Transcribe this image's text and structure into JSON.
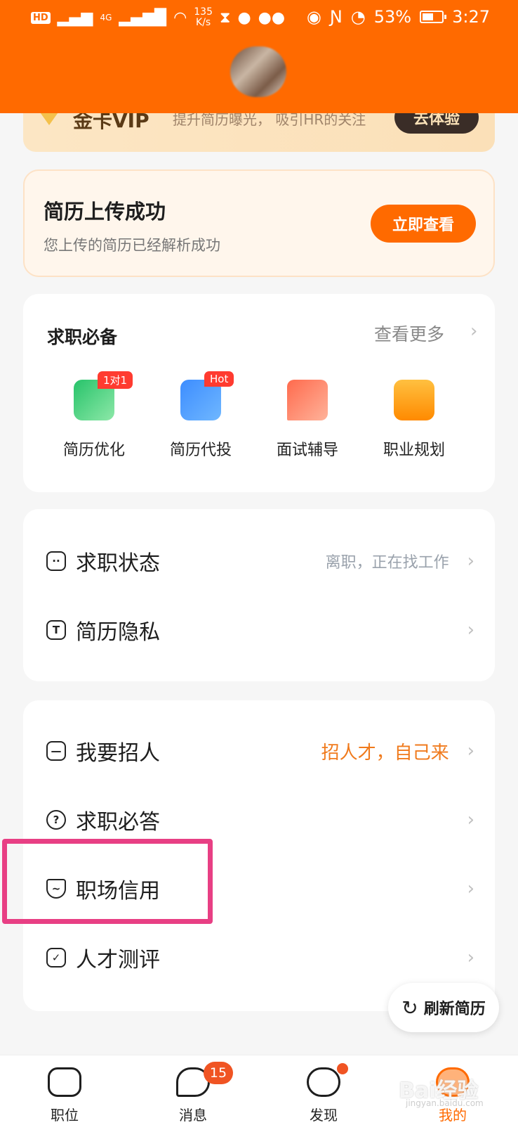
{
  "status_bar": {
    "hd": "HD",
    "network": "4G",
    "net_speed_value": "135",
    "net_speed_unit": "K/s",
    "battery": "53%",
    "time": "3:27"
  },
  "vip": {
    "title": "金卡VIP",
    "desc": "提升简历曝光， 吸引HR的关注",
    "button": "去体验"
  },
  "upload": {
    "title": "简历上传成功",
    "desc": "您上传的简历已经解析成功",
    "button": "立即查看"
  },
  "essentials": {
    "title": "求职必备",
    "more": "查看更多",
    "tools": [
      {
        "label": "简历优化",
        "tag": "1对1",
        "icon": "resume-edit-icon"
      },
      {
        "label": "简历代投",
        "tag": "Hot",
        "icon": "mail-star-icon"
      },
      {
        "label": "面试辅导",
        "tag": "",
        "icon": "chat-bubble-icon"
      },
      {
        "label": "职业规划",
        "tag": "",
        "icon": "briefcase-icon"
      }
    ]
  },
  "settings": {
    "status": {
      "label": "求职状态",
      "value": "离职，正在找工作"
    },
    "privacy": {
      "label": "简历隐私"
    }
  },
  "more": {
    "recruit": {
      "label": "我要招人",
      "value": "招人才，自己来"
    },
    "qa": {
      "label": "求职必答"
    },
    "credit": {
      "label": "职场信用"
    },
    "assess": {
      "label": "人才测评"
    }
  },
  "refresh": {
    "label": "刷新简历"
  },
  "nav": {
    "jobs": "职位",
    "messages": "消息",
    "messages_badge": "15",
    "discover": "发现",
    "mine": "我的"
  },
  "watermark": {
    "main": "Bai经验",
    "sub": "jingyan.baidu.com"
  },
  "colors": {
    "accent": "#ff6a00",
    "highlight": "#e83f84",
    "badge": "#f05423"
  }
}
